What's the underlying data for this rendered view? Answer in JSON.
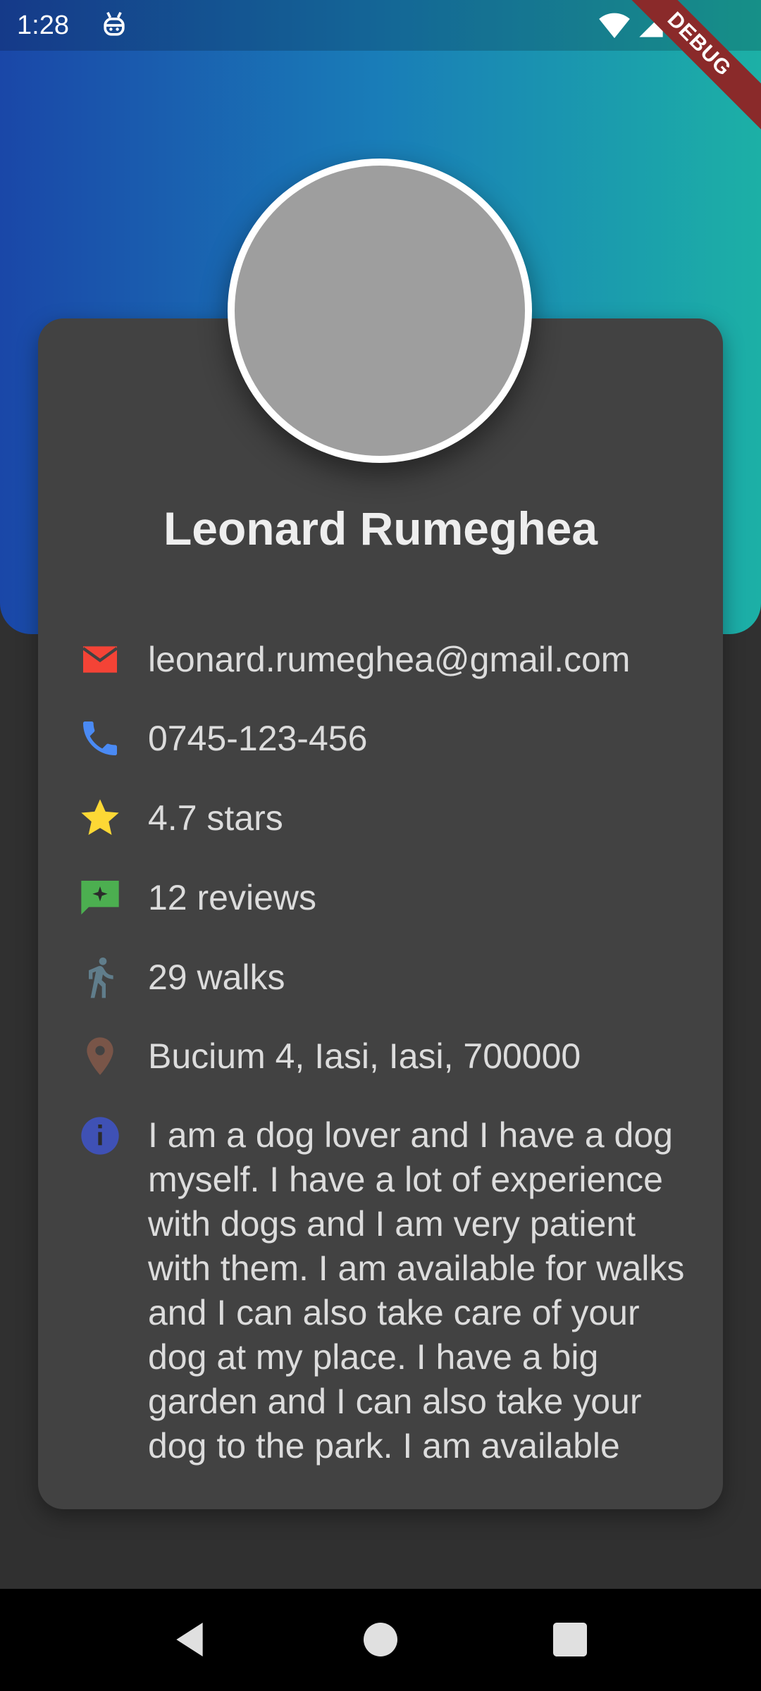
{
  "status_bar": {
    "time": "1:28",
    "icons": [
      "debug-robot-icon",
      "wifi-icon",
      "cell-signal-icon",
      "battery-icon"
    ]
  },
  "debug_banner": "DEBUG",
  "profile": {
    "name": "Leonard Rumeghea",
    "email": "leonard.rumeghea@gmail.com",
    "phone": "0745-123-456",
    "rating": "4.7 stars",
    "reviews": "12 reviews",
    "walks": "29 walks",
    "address": "Bucium 4, Iasi, Iasi, 700000",
    "about": "I am a dog lover and I have a dog myself. I have a lot of experience with dogs and I am very patient with them. I am available for walks and I can also take care of your dog at my place. I have a big garden and I can also take your dog to the park. I am available"
  },
  "colors": {
    "gradient_start": "#1a47a8",
    "gradient_end": "#1cb0a6",
    "card": "#424242",
    "background": "#303030",
    "email_icon": "#f44336",
    "phone_icon": "#4a8af4",
    "star_icon": "#fdd835",
    "reviews_icon": "#4caf50",
    "walk_icon": "#607d8b",
    "location_icon": "#795548",
    "info_icon": "#3f51b5"
  },
  "nav_bar": {
    "icons": [
      "back-icon",
      "home-icon",
      "recents-icon"
    ]
  }
}
